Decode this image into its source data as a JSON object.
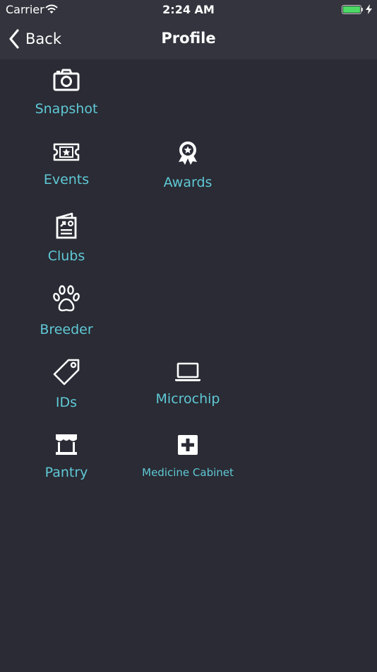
{
  "status_bar": {
    "carrier": "Carrier",
    "time": "2:24 AM",
    "battery_level": 1.0,
    "battery_color": "#4cd964"
  },
  "nav": {
    "back_label": "Back",
    "title": "Profile"
  },
  "accent_color": "#5fc9d6",
  "menu": {
    "snapshot": {
      "label": "Snapshot",
      "icon": "camera-icon"
    },
    "events": {
      "label": "Events",
      "icon": "ticket-icon"
    },
    "awards": {
      "label": "Awards",
      "icon": "award-ribbon-icon"
    },
    "clubs": {
      "label": "Clubs",
      "icon": "newspaper-icon"
    },
    "breeder": {
      "label": "Breeder",
      "icon": "paw-icon"
    },
    "ids": {
      "label": "IDs",
      "icon": "tag-icon"
    },
    "microchip": {
      "label": "Microchip",
      "icon": "laptop-icon"
    },
    "pantry": {
      "label": "Pantry",
      "icon": "storefront-icon"
    },
    "medicine_cabinet": {
      "label": "Medicine Cabinet",
      "icon": "medical-cross-icon"
    }
  }
}
